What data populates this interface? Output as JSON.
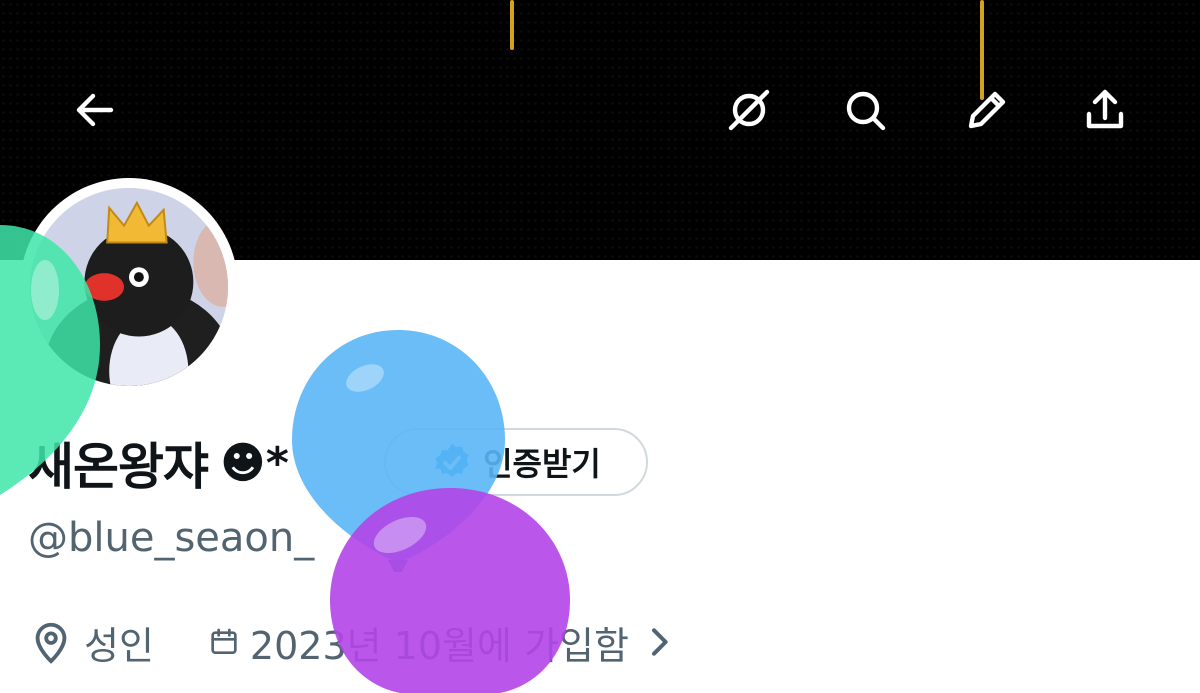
{
  "header": {
    "back_icon": "arrow-left-icon",
    "actions": [
      {
        "name": "grok-icon"
      },
      {
        "name": "search-icon"
      },
      {
        "name": "pencil-icon"
      },
      {
        "name": "share-icon"
      }
    ]
  },
  "profile": {
    "display_name": "새온왕쟈",
    "name_suffix": "☻*",
    "verify_label": "인증받기",
    "handle": "@blue_seaon_",
    "location": "성인",
    "joined": "2023년 10월에 가입함"
  },
  "colors": {
    "banner": "#000000",
    "text_primary": "#0f1419",
    "text_secondary": "#536471",
    "verified_blue": "#1d9bf0",
    "balloon_green": "#3ee6a8",
    "balloon_blue": "#5ab6f5",
    "balloon_purple": "#b245e8"
  }
}
